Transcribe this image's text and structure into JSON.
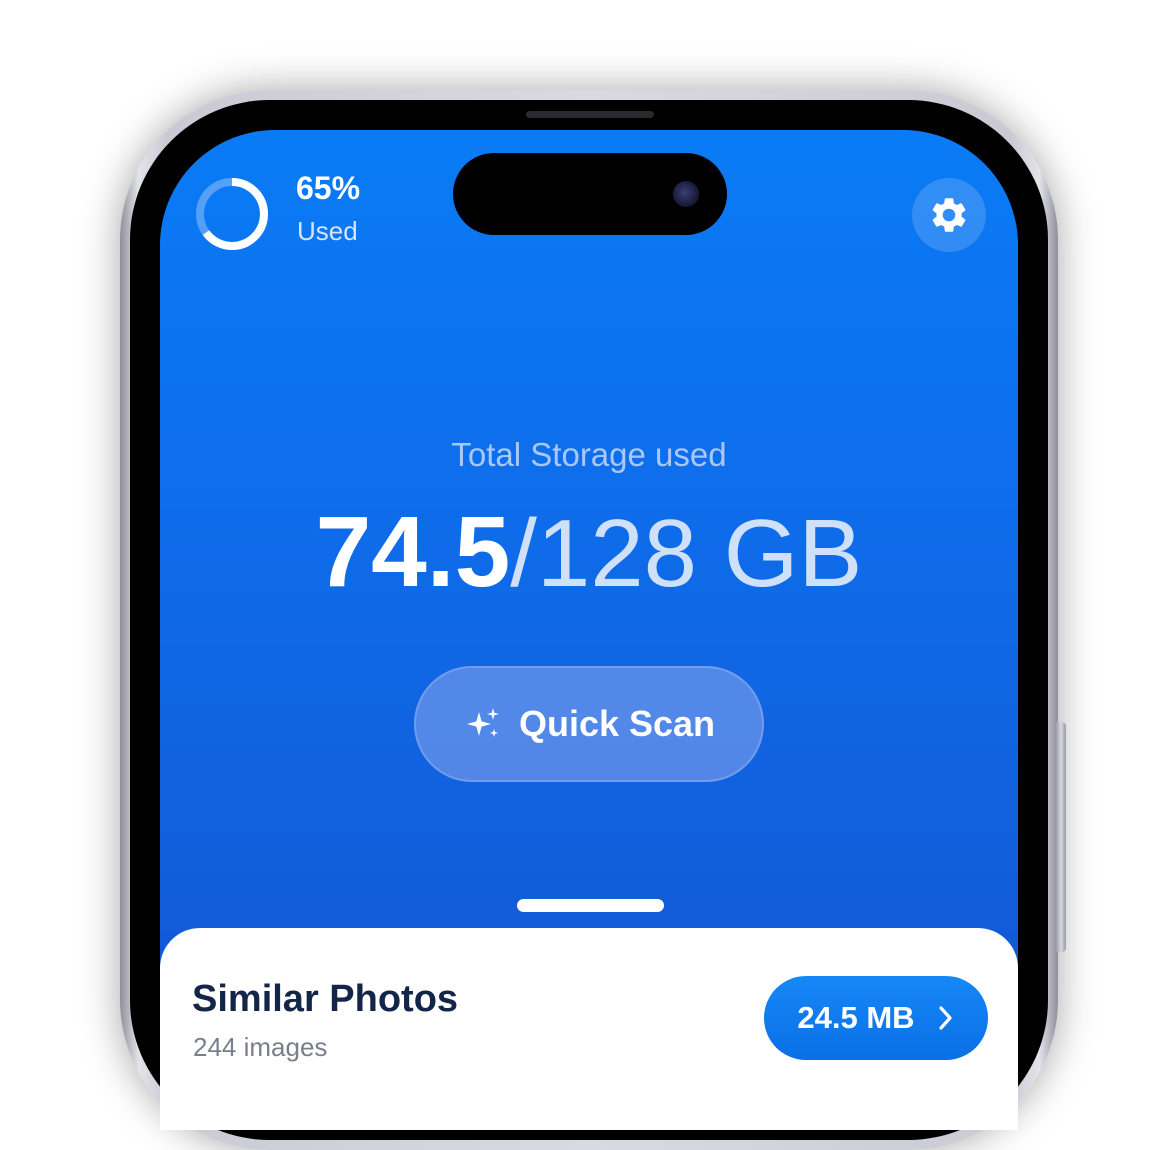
{
  "status": {
    "usage_percent": "65%",
    "usage_value": 0.65,
    "usage_label": "Used"
  },
  "storage": {
    "heading": "Total Storage used",
    "used": "74.5",
    "separator": "/",
    "total": "128 GB"
  },
  "actions": {
    "quick_scan_label": "Quick Scan",
    "quick_scan_icon": "sparkles-icon",
    "settings_icon": "gear-icon"
  },
  "card": {
    "title": "Similar Photos",
    "subtitle": "244 images",
    "size": "24.5 MB",
    "size_icon": "chevron-right-icon"
  },
  "colors": {
    "accent": "#0a7bf6",
    "accent_dark": "#1453cf",
    "card_title": "#14254a",
    "card_subtitle": "#7a7f8c"
  }
}
